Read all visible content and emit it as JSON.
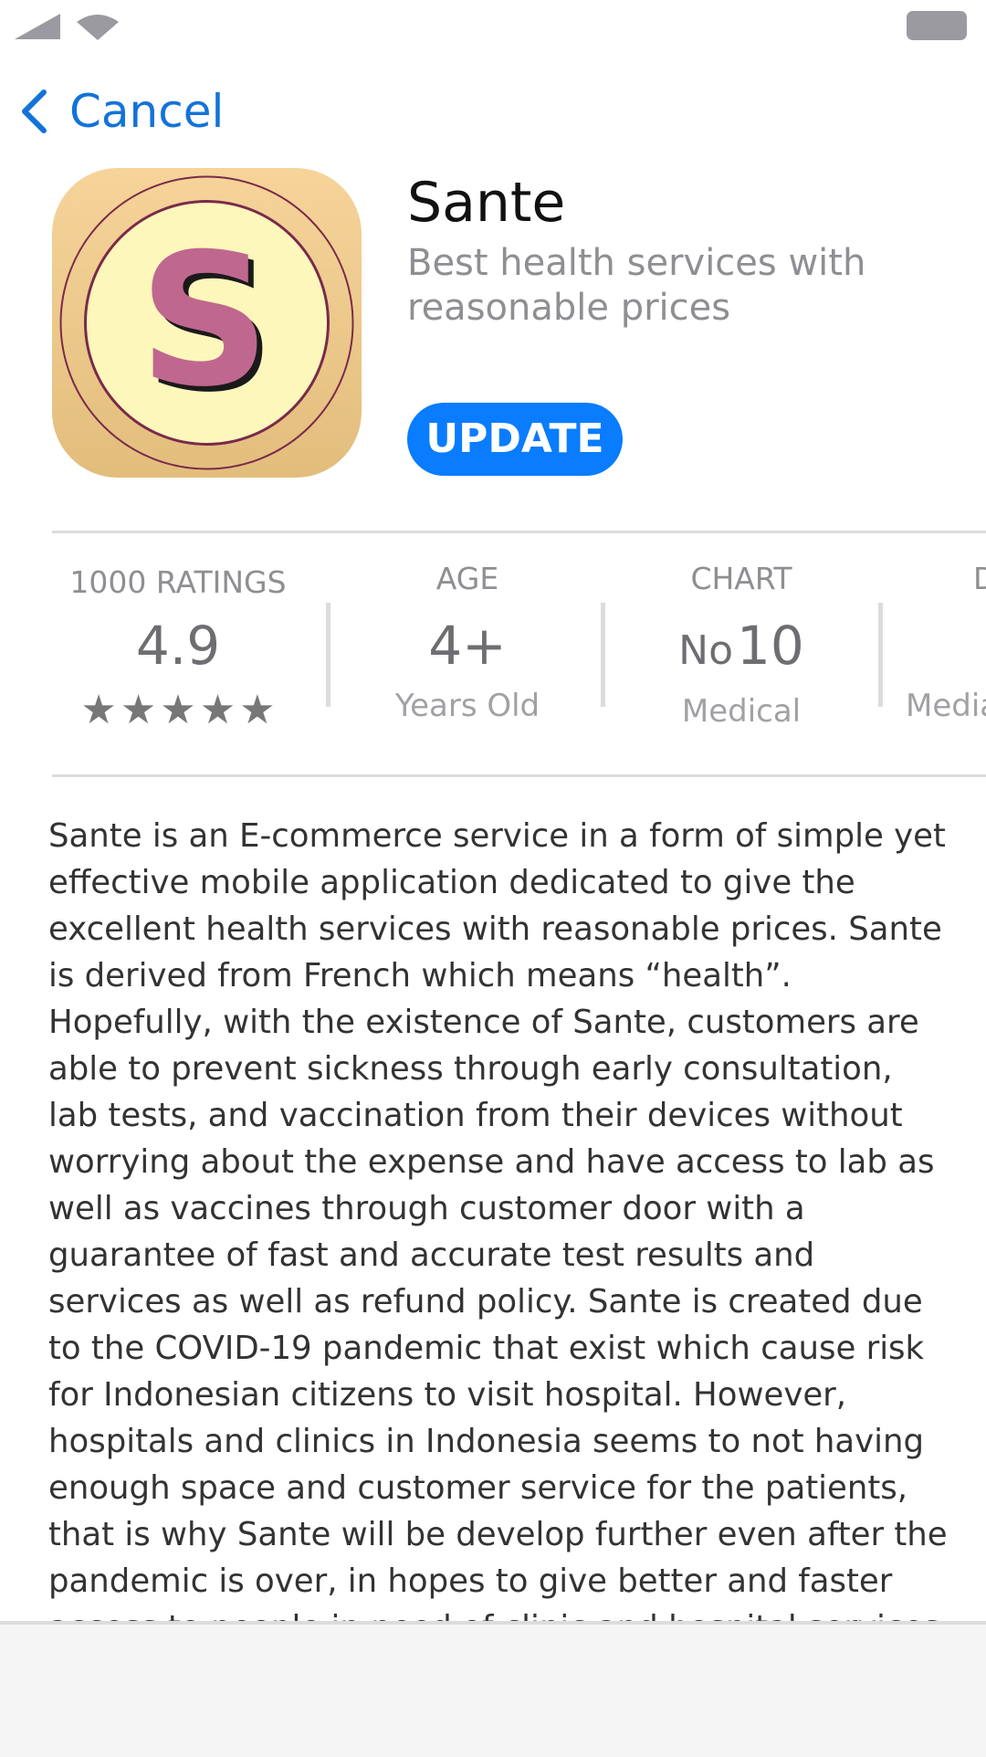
{
  "nav": {
    "back_label": "Cancel"
  },
  "app": {
    "icon_letter": "S",
    "name": "Sante",
    "subtitle": "Best health services with reasonable prices",
    "update_label": "UPDATE"
  },
  "stats": {
    "ratings": {
      "caption": "1000 RATINGS",
      "value": "4.9",
      "stars": 5
    },
    "age": {
      "caption": "AGE",
      "value": "4+",
      "sub": "Years Old"
    },
    "chart": {
      "caption": "CHART",
      "prefix": "No",
      "value": "10",
      "sub": "Medical"
    },
    "partial": {
      "caption": "D",
      "sub": "Media"
    }
  },
  "description": "Sante is an E-commerce service in a form of simple yet effective mobile application dedicated to give the excel­lent health services with reasonable prices. Sante is de­rived from French which means “health”. Hopefully, with the existence of Sante, customers are able to prevent sickness through early consultation, lab tests, and vacci­nation from their devices without worrying about the ex­pense and have access to lab as well as vaccines through customer door with a guarantee of fast and accurate test results and services as well as refund policy. Sante is cre­ated due to the COVID-19 pandemic that exist which cause risk for Indonesian citizens to visit hospital. Howev­er, hospitals and clinics in Indonesia seems to not having enough space and customer service for the patients, that is why Sante will be develop further even after the pan­demic is over, in hopes to give better and faster access to people in need of clinic and hospital services.",
  "colors": {
    "accent": "#0a7cff",
    "link": "#1373d8",
    "icon_gold": "#f0c98a",
    "icon_inner": "#fdf7bb",
    "icon_letter": "#c0678f"
  },
  "icons": [
    "signal-icon",
    "wifi-icon",
    "battery-icon",
    "chevron-left-icon",
    "star-icon"
  ]
}
